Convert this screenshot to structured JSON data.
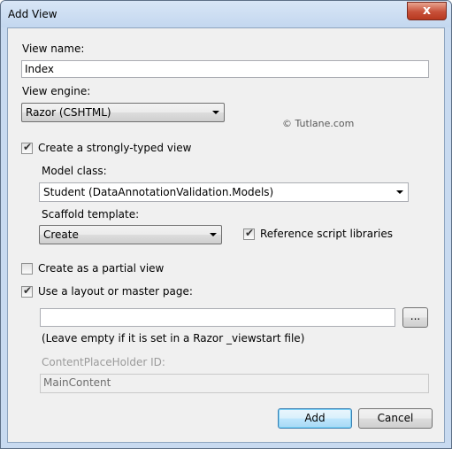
{
  "window": {
    "title": "Add View",
    "close_glyph": "x"
  },
  "view_name": {
    "label": "View name:",
    "value": "Index"
  },
  "view_engine": {
    "label": "View engine:",
    "selected": "Razor (CSHTML)"
  },
  "watermark": "© Tutlane.com",
  "strongly_typed": {
    "label": "Create a strongly-typed view",
    "checked": true
  },
  "model_class": {
    "label": "Model class:",
    "selected": "Student (DataAnnotationValidation.Models)"
  },
  "scaffold_template": {
    "label": "Scaffold template:",
    "selected": "Create"
  },
  "reference_scripts": {
    "label": "Reference script libraries",
    "checked": true
  },
  "partial_view": {
    "label": "Create as a partial view",
    "checked": false
  },
  "layout_page": {
    "label": "Use a layout or master page:",
    "checked": true,
    "value": "",
    "browse_label": "...",
    "hint": "(Leave empty if it is set in a Razor _viewstart file)"
  },
  "content_placeholder": {
    "label": "ContentPlaceHolder ID:",
    "value": "MainContent"
  },
  "buttons": {
    "add": "Add",
    "cancel": "Cancel"
  },
  "icons": {
    "check": "check-icon",
    "dropdown": "chevron-down-icon",
    "close": "close-icon"
  },
  "colors": {
    "titlebar": "#c8daf0",
    "client": "#f0f0f0",
    "close": "#c75039",
    "default_button_border": "#3c7fb1"
  }
}
